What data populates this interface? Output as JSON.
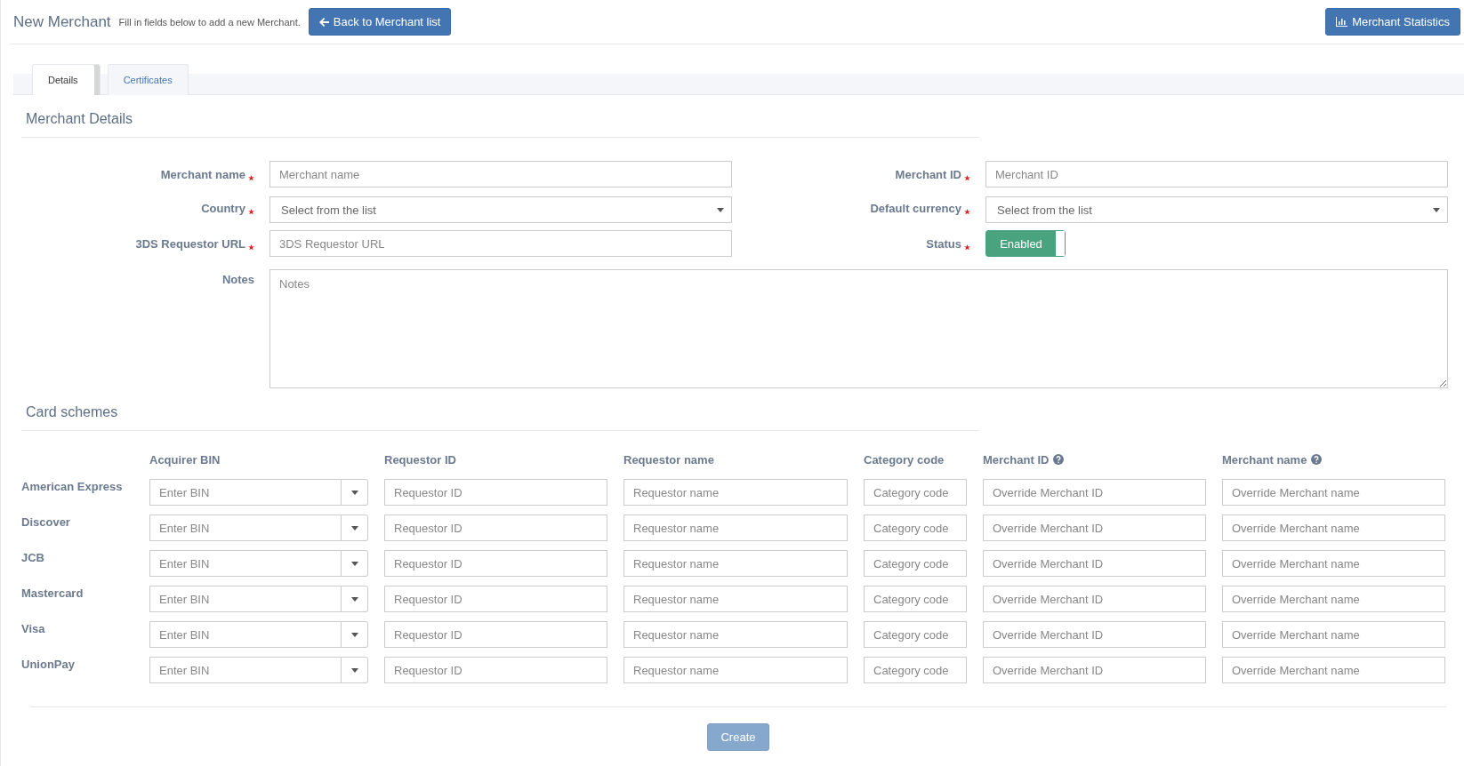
{
  "header": {
    "title": "New Merchant",
    "subtitle": "Fill in fields below to add a new Merchant.",
    "back_button": "Back to Merchant list",
    "stats_button": "Merchant Statistics"
  },
  "tabs": [
    {
      "label": "Details",
      "selected": true
    },
    {
      "label": "Certificates",
      "selected": false
    }
  ],
  "merchant_details": {
    "title": "Merchant Details",
    "fields": [
      {
        "label": "Merchant name",
        "required": true,
        "kind": "text",
        "placeholder": "Merchant name"
      },
      {
        "label": "Merchant ID",
        "required": true,
        "kind": "text",
        "placeholder": "Merchant ID"
      },
      {
        "label": "Country",
        "required": true,
        "kind": "select",
        "placeholder": "Select from the list"
      },
      {
        "label": "Default currency",
        "required": true,
        "kind": "select",
        "placeholder": "Select from the list"
      },
      {
        "label": "3DS Requestor URL",
        "required": true,
        "kind": "text",
        "placeholder": "3DS Requestor URL"
      },
      {
        "label": "Status",
        "required": true,
        "kind": "toggle",
        "value": "Enabled",
        "on": true
      },
      {
        "label": "Notes",
        "required": false,
        "kind": "textarea",
        "placeholder": "Notes"
      }
    ]
  },
  "card_schemes": {
    "title": "Card schemes",
    "columns": [
      {
        "label": "Acquirer BIN",
        "help": false
      },
      {
        "label": "Requestor ID",
        "help": false
      },
      {
        "label": "Requestor name",
        "help": false
      },
      {
        "label": "Category code",
        "help": false
      },
      {
        "label": "Merchant ID",
        "help": true
      },
      {
        "label": "Merchant name",
        "help": true
      }
    ],
    "rows": [
      {
        "scheme": "American Express",
        "fields": [
          {
            "kind": "combo",
            "placeholder": "Enter BIN"
          },
          {
            "kind": "text",
            "placeholder": "Requestor ID"
          },
          {
            "kind": "text",
            "placeholder": "Requestor name"
          },
          {
            "kind": "text",
            "placeholder": "Category code"
          },
          {
            "kind": "text",
            "placeholder": "Override Merchant ID"
          },
          {
            "kind": "text",
            "placeholder": "Override Merchant name"
          }
        ]
      },
      {
        "scheme": "Discover",
        "fields": [
          {
            "kind": "combo",
            "placeholder": "Enter BIN"
          },
          {
            "kind": "text",
            "placeholder": "Requestor ID"
          },
          {
            "kind": "text",
            "placeholder": "Requestor name"
          },
          {
            "kind": "text",
            "placeholder": "Category code"
          },
          {
            "kind": "text",
            "placeholder": "Override Merchant ID"
          },
          {
            "kind": "text",
            "placeholder": "Override Merchant name"
          }
        ]
      },
      {
        "scheme": "JCB",
        "fields": [
          {
            "kind": "combo",
            "placeholder": "Enter BIN"
          },
          {
            "kind": "text",
            "placeholder": "Requestor ID"
          },
          {
            "kind": "text",
            "placeholder": "Requestor name"
          },
          {
            "kind": "text",
            "placeholder": "Category code"
          },
          {
            "kind": "text",
            "placeholder": "Override Merchant ID"
          },
          {
            "kind": "text",
            "placeholder": "Override Merchant name"
          }
        ]
      },
      {
        "scheme": "Mastercard",
        "fields": [
          {
            "kind": "combo",
            "placeholder": "Enter BIN"
          },
          {
            "kind": "text",
            "placeholder": "Requestor ID"
          },
          {
            "kind": "text",
            "placeholder": "Requestor name"
          },
          {
            "kind": "text",
            "placeholder": "Category code"
          },
          {
            "kind": "text",
            "placeholder": "Override Merchant ID"
          },
          {
            "kind": "text",
            "placeholder": "Override Merchant name"
          }
        ]
      },
      {
        "scheme": "Visa",
        "fields": [
          {
            "kind": "combo",
            "placeholder": "Enter BIN"
          },
          {
            "kind": "text",
            "placeholder": "Requestor ID"
          },
          {
            "kind": "text",
            "placeholder": "Requestor name"
          },
          {
            "kind": "text",
            "placeholder": "Category code"
          },
          {
            "kind": "text",
            "placeholder": "Override Merchant ID"
          },
          {
            "kind": "text",
            "placeholder": "Override Merchant name"
          }
        ]
      },
      {
        "scheme": "UnionPay",
        "fields": [
          {
            "kind": "combo",
            "placeholder": "Enter BIN"
          },
          {
            "kind": "text",
            "placeholder": "Requestor ID"
          },
          {
            "kind": "text",
            "placeholder": "Requestor name"
          },
          {
            "kind": "text",
            "placeholder": "Category code"
          },
          {
            "kind": "text",
            "placeholder": "Override Merchant ID"
          },
          {
            "kind": "text",
            "placeholder": "Override Merchant name"
          }
        ]
      }
    ]
  },
  "create_button": {
    "label": "Create",
    "disabled": true
  }
}
